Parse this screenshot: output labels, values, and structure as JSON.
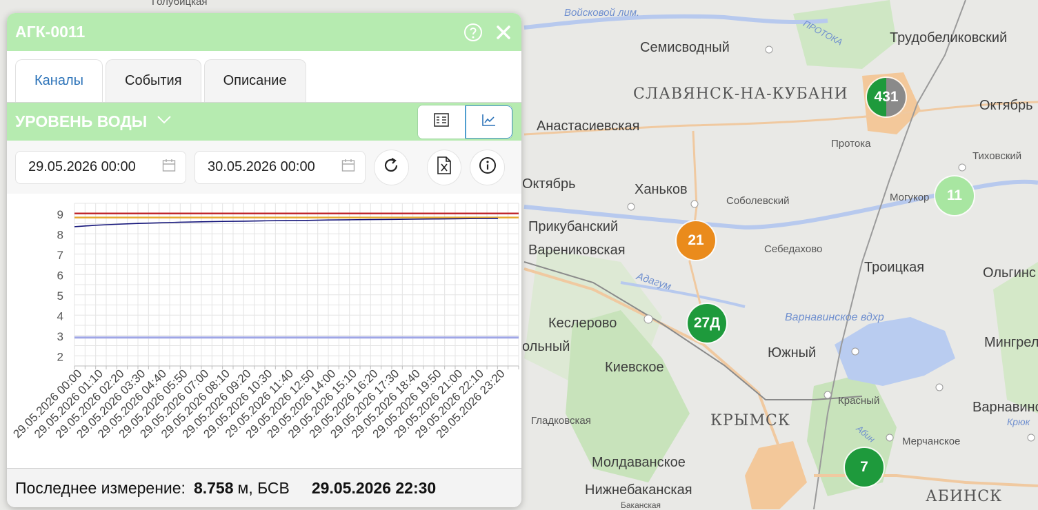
{
  "panel": {
    "title": "АГК-0011",
    "tabs": [
      {
        "label": "Каналы",
        "active": true
      },
      {
        "label": "События",
        "active": false
      },
      {
        "label": "Описание",
        "active": false
      }
    ],
    "channel": {
      "title": "УРОВЕНЬ ВОДЫ"
    },
    "view_toggle": {
      "selected": "chart"
    },
    "date_from": "29.05.2026 00:00",
    "date_to": "30.05.2026 00:00",
    "footer": {
      "label": "Последнее измерение:",
      "value": "8.758",
      "unit": "м, БСВ",
      "time": "29.05.2026 22:30"
    }
  },
  "chart_data": {
    "type": "line",
    "ylim": [
      1.5,
      9.5
    ],
    "yticks": [
      2,
      3,
      4,
      5,
      6,
      7,
      8,
      9
    ],
    "categories": [
      "29.05.2026 00:00",
      "29.05.2026 01:10",
      "29.05.2026 02:20",
      "29.05.2026 03:30",
      "29.05.2026 04:40",
      "29.05.2026 05:50",
      "29.05.2026 07:00",
      "29.05.2026 08:10",
      "29.05.2026 09:20",
      "29.05.2026 10:30",
      "29.05.2026 11:40",
      "29.05.2026 12:50",
      "29.05.2026 14:00",
      "29.05.2026 15:10",
      "29.05.2026 16:20",
      "29.05.2026 17:30",
      "29.05.2026 18:40",
      "29.05.2026 19:50",
      "29.05.2026 21:00",
      "29.05.2026 22:10",
      "29.05.2026 23:20"
    ],
    "thresholds": [
      {
        "value": 9.0,
        "color": "#c0282d"
      },
      {
        "value": 8.8,
        "color": "#e6a830"
      },
      {
        "value": 2.9,
        "color": "#9fa6e6"
      }
    ],
    "series": [
      {
        "color": "#14157a",
        "values": [
          8.35,
          8.42,
          8.47,
          8.51,
          8.54,
          8.57,
          8.59,
          8.61,
          8.62,
          8.64,
          8.65,
          8.66,
          8.68,
          8.69,
          8.7,
          8.71,
          8.72,
          8.73,
          8.74,
          8.75,
          8.76
        ]
      }
    ],
    "grid": true
  },
  "map": {
    "labels": {
      "l1": "Голубицкая",
      "l2": "Войсковой лим.",
      "l3": "Семисводный",
      "l4": "Трудобеликовский",
      "l5": "СЛАВЯНСК-НА-КУБАНИ",
      "l6": "Анастасиевская",
      "l7": "Октябрь",
      "l8": "Протока",
      "l9": "Тиховский",
      "l10": "Октябрь",
      "l11": "Ханьков",
      "l12": "Соболевский",
      "l13": "Могукор",
      "l14": "Прикубанский",
      "l15": "Варениковская",
      "l16": "Себедахово",
      "l17": "Троицкая",
      "l18": "Ольгинс",
      "l19": "Адагум",
      "l20": "Кеслерово",
      "l21": "Варнавинское вдхр",
      "l22": "Мингрельс",
      "l23": "Киевское",
      "l24": "Южный",
      "l25": "Красный",
      "l26": "Варнавинск",
      "l27": "Гладковская",
      "l28": "КРЫМСК",
      "l29": "Мерчанское",
      "l30": "Молдаванское",
      "l31": "Нижнебаканская",
      "l32": "АБИНСК",
      "l33": "ПРОТОКА",
      "l34": "Абин",
      "l35": "Крюк",
      "l36": "ольный",
      "l37": "Баканская"
    },
    "clusters": [
      {
        "id": "c431",
        "label": "431",
        "colors": [
          "#1e9a3c",
          "#8a8a8a"
        ]
      },
      {
        "id": "c11",
        "label": "11",
        "colors": [
          "#a8e6a1"
        ]
      },
      {
        "id": "c21",
        "label": "21",
        "colors": [
          "#ea8b1c"
        ]
      },
      {
        "id": "c27",
        "label": "27Д",
        "colors": [
          "#1e9a3c"
        ]
      },
      {
        "id": "c7",
        "label": "7",
        "colors": [
          "#1e9a3c"
        ]
      }
    ]
  }
}
